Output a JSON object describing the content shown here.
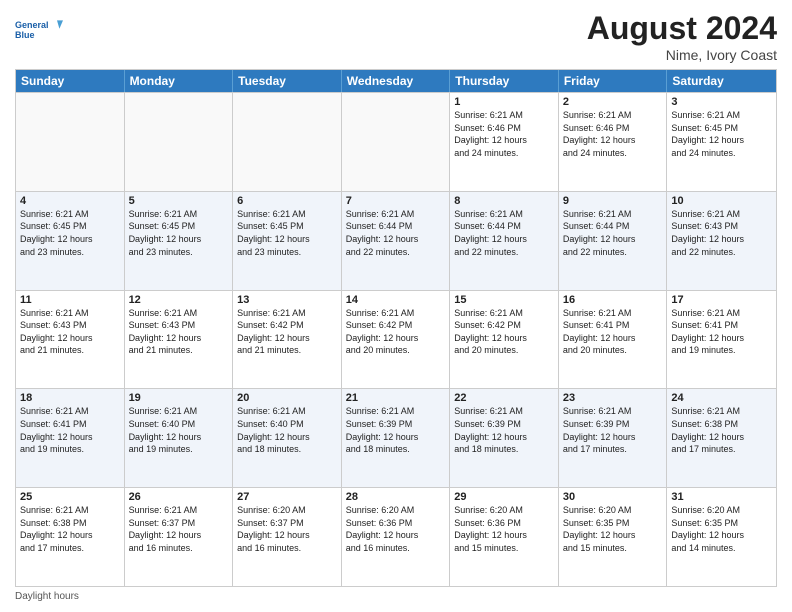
{
  "header": {
    "logo_general": "General",
    "logo_blue": "Blue",
    "month_year": "August 2024",
    "location": "Nime, Ivory Coast"
  },
  "days_of_week": [
    "Sunday",
    "Monday",
    "Tuesday",
    "Wednesday",
    "Thursday",
    "Friday",
    "Saturday"
  ],
  "weeks": [
    [
      {
        "day": "",
        "empty": true
      },
      {
        "day": "",
        "empty": true
      },
      {
        "day": "",
        "empty": true
      },
      {
        "day": "",
        "empty": true
      },
      {
        "day": "1",
        "info": "Sunrise: 6:21 AM\nSunset: 6:46 PM\nDaylight: 12 hours\nand 24 minutes."
      },
      {
        "day": "2",
        "info": "Sunrise: 6:21 AM\nSunset: 6:46 PM\nDaylight: 12 hours\nand 24 minutes."
      },
      {
        "day": "3",
        "info": "Sunrise: 6:21 AM\nSunset: 6:45 PM\nDaylight: 12 hours\nand 24 minutes."
      }
    ],
    [
      {
        "day": "4",
        "info": "Sunrise: 6:21 AM\nSunset: 6:45 PM\nDaylight: 12 hours\nand 23 minutes."
      },
      {
        "day": "5",
        "info": "Sunrise: 6:21 AM\nSunset: 6:45 PM\nDaylight: 12 hours\nand 23 minutes."
      },
      {
        "day": "6",
        "info": "Sunrise: 6:21 AM\nSunset: 6:45 PM\nDaylight: 12 hours\nand 23 minutes."
      },
      {
        "day": "7",
        "info": "Sunrise: 6:21 AM\nSunset: 6:44 PM\nDaylight: 12 hours\nand 22 minutes."
      },
      {
        "day": "8",
        "info": "Sunrise: 6:21 AM\nSunset: 6:44 PM\nDaylight: 12 hours\nand 22 minutes."
      },
      {
        "day": "9",
        "info": "Sunrise: 6:21 AM\nSunset: 6:44 PM\nDaylight: 12 hours\nand 22 minutes."
      },
      {
        "day": "10",
        "info": "Sunrise: 6:21 AM\nSunset: 6:43 PM\nDaylight: 12 hours\nand 22 minutes."
      }
    ],
    [
      {
        "day": "11",
        "info": "Sunrise: 6:21 AM\nSunset: 6:43 PM\nDaylight: 12 hours\nand 21 minutes."
      },
      {
        "day": "12",
        "info": "Sunrise: 6:21 AM\nSunset: 6:43 PM\nDaylight: 12 hours\nand 21 minutes."
      },
      {
        "day": "13",
        "info": "Sunrise: 6:21 AM\nSunset: 6:42 PM\nDaylight: 12 hours\nand 21 minutes."
      },
      {
        "day": "14",
        "info": "Sunrise: 6:21 AM\nSunset: 6:42 PM\nDaylight: 12 hours\nand 20 minutes."
      },
      {
        "day": "15",
        "info": "Sunrise: 6:21 AM\nSunset: 6:42 PM\nDaylight: 12 hours\nand 20 minutes."
      },
      {
        "day": "16",
        "info": "Sunrise: 6:21 AM\nSunset: 6:41 PM\nDaylight: 12 hours\nand 20 minutes."
      },
      {
        "day": "17",
        "info": "Sunrise: 6:21 AM\nSunset: 6:41 PM\nDaylight: 12 hours\nand 19 minutes."
      }
    ],
    [
      {
        "day": "18",
        "info": "Sunrise: 6:21 AM\nSunset: 6:41 PM\nDaylight: 12 hours\nand 19 minutes."
      },
      {
        "day": "19",
        "info": "Sunrise: 6:21 AM\nSunset: 6:40 PM\nDaylight: 12 hours\nand 19 minutes."
      },
      {
        "day": "20",
        "info": "Sunrise: 6:21 AM\nSunset: 6:40 PM\nDaylight: 12 hours\nand 18 minutes."
      },
      {
        "day": "21",
        "info": "Sunrise: 6:21 AM\nSunset: 6:39 PM\nDaylight: 12 hours\nand 18 minutes."
      },
      {
        "day": "22",
        "info": "Sunrise: 6:21 AM\nSunset: 6:39 PM\nDaylight: 12 hours\nand 18 minutes."
      },
      {
        "day": "23",
        "info": "Sunrise: 6:21 AM\nSunset: 6:39 PM\nDaylight: 12 hours\nand 17 minutes."
      },
      {
        "day": "24",
        "info": "Sunrise: 6:21 AM\nSunset: 6:38 PM\nDaylight: 12 hours\nand 17 minutes."
      }
    ],
    [
      {
        "day": "25",
        "info": "Sunrise: 6:21 AM\nSunset: 6:38 PM\nDaylight: 12 hours\nand 17 minutes."
      },
      {
        "day": "26",
        "info": "Sunrise: 6:21 AM\nSunset: 6:37 PM\nDaylight: 12 hours\nand 16 minutes."
      },
      {
        "day": "27",
        "info": "Sunrise: 6:20 AM\nSunset: 6:37 PM\nDaylight: 12 hours\nand 16 minutes."
      },
      {
        "day": "28",
        "info": "Sunrise: 6:20 AM\nSunset: 6:36 PM\nDaylight: 12 hours\nand 16 minutes."
      },
      {
        "day": "29",
        "info": "Sunrise: 6:20 AM\nSunset: 6:36 PM\nDaylight: 12 hours\nand 15 minutes."
      },
      {
        "day": "30",
        "info": "Sunrise: 6:20 AM\nSunset: 6:35 PM\nDaylight: 12 hours\nand 15 minutes."
      },
      {
        "day": "31",
        "info": "Sunrise: 6:20 AM\nSunset: 6:35 PM\nDaylight: 12 hours\nand 14 minutes."
      }
    ]
  ],
  "footer": {
    "daylight_hours": "Daylight hours"
  }
}
